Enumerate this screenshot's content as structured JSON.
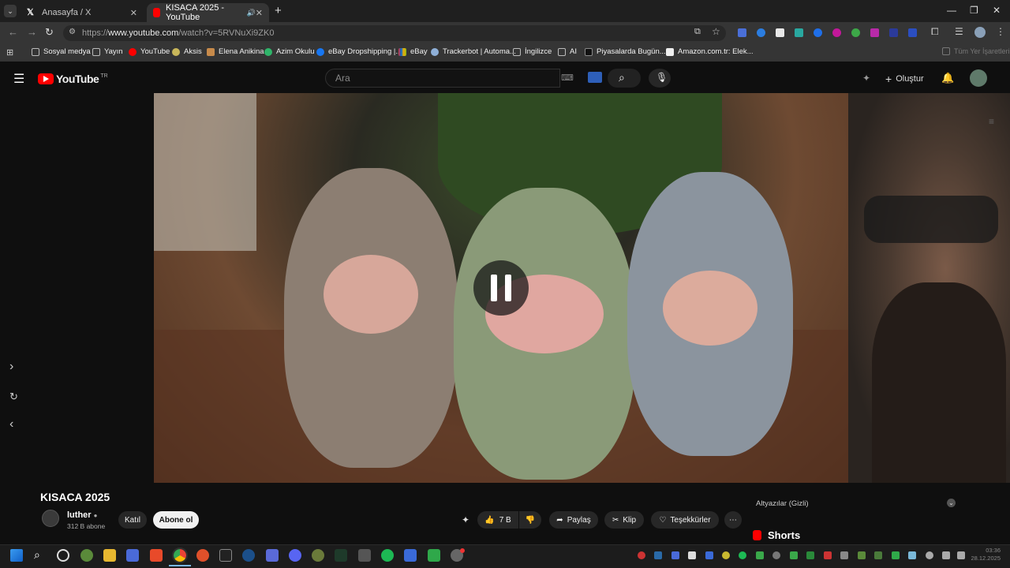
{
  "browser": {
    "tabs": [
      {
        "label": "Anasayfa / X"
      },
      {
        "label": "KISACA 2025 - YouTube"
      }
    ],
    "url_prefix": "https://",
    "url_host": "www.youtube.com",
    "url_path": "/watch?v=5RVNuXi9ZK0",
    "bookmarks": [
      {
        "label": "Sosyal medya"
      },
      {
        "label": "Yayın"
      },
      {
        "label": "YouTube"
      },
      {
        "label": "Aksis"
      },
      {
        "label": "Elena Anikina"
      },
      {
        "label": "Azim Okulu"
      },
      {
        "label": "eBay Dropshipping |..."
      },
      {
        "label": "eBay"
      },
      {
        "label": "Trackerbot | Automa..."
      },
      {
        "label": "İngilizce"
      },
      {
        "label": "AI"
      },
      {
        "label": "Piyasalarda Bugün..."
      },
      {
        "label": "Amazon.com.tr: Elek..."
      },
      {
        "label": "Tüm Yer İşaretleri"
      }
    ]
  },
  "youtube": {
    "logo_text": "YouTube",
    "logo_region": "TR",
    "search_placeholder": "Ara",
    "create_label": "Oluştur",
    "video_title": "KISACA 2025",
    "channel_name": "luther",
    "subscribers": "312 B abone",
    "join_label": "Katıl",
    "subscribe_label": "Abone ol",
    "likes": "7 B",
    "share_label": "Paylaş",
    "clip_label": "Klip",
    "thanks_label": "Teşekkürler",
    "subtitles_label": "Altyazılar (Gizli)",
    "shorts_label": "Shorts"
  },
  "taskbar": {
    "time": "03:36",
    "date": "28.12.2025"
  },
  "colors": {
    "youtube_red": "#ff0000",
    "bg": "#0f0f0f",
    "tab_active": "#353535"
  }
}
